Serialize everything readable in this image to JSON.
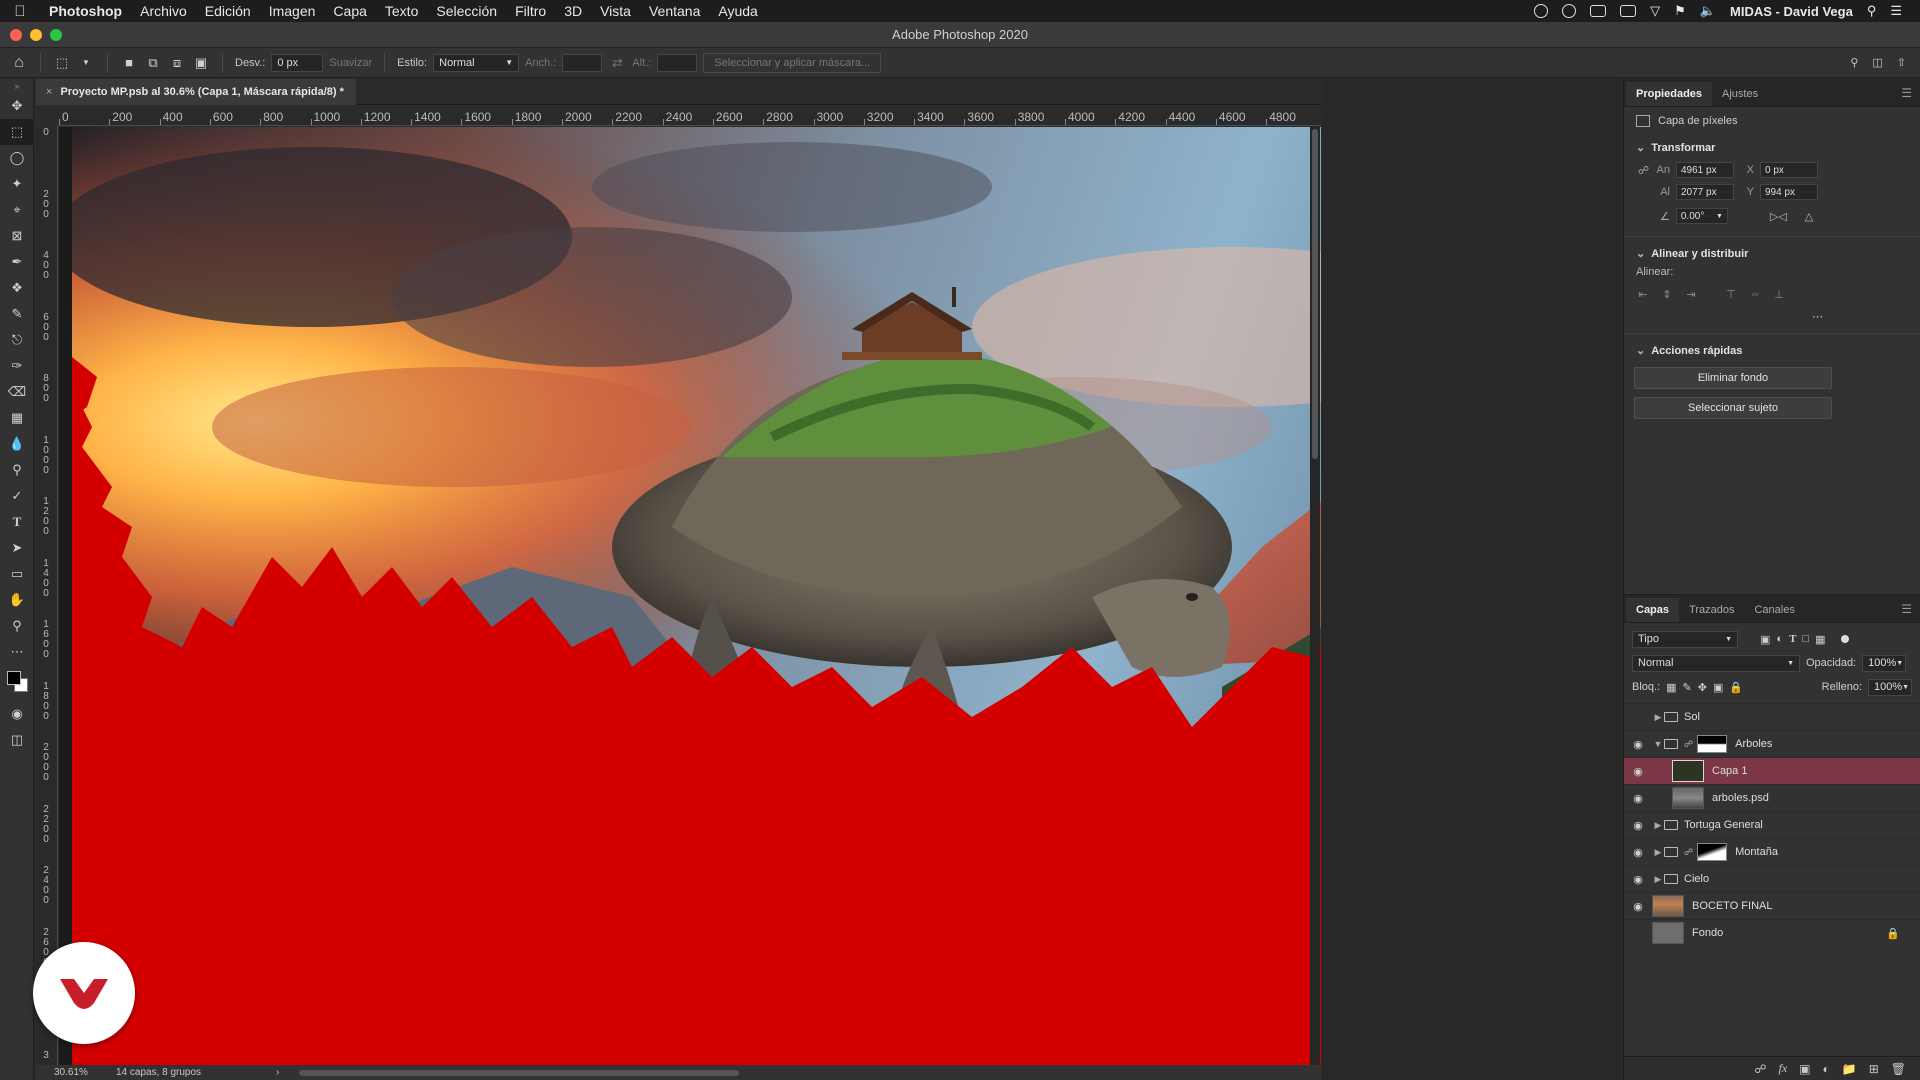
{
  "menubar": {
    "app_name": "Photoshop",
    "items": [
      "Archivo",
      "Edición",
      "Imagen",
      "Capa",
      "Texto",
      "Selección",
      "Filtro",
      "3D",
      "Vista",
      "Ventana",
      "Ayuda"
    ],
    "user": "MIDAS - David Vega"
  },
  "window": {
    "title": "Adobe Photoshop 2020"
  },
  "options": {
    "feather_label": "Desv.:",
    "feather_value": "0 px",
    "smooth_label": "Suavizar",
    "style_label": "Estilo:",
    "style_value": "Normal",
    "width_label": "Anch.:",
    "height_label": "Alt.:",
    "mask_button": "Seleccionar y aplicar máscara..."
  },
  "document": {
    "tab_title": "Proyecto MP.psb al 30.6% (Capa 1, Máscara rápida/8) *",
    "zoom": "30.61%",
    "status_info": "14 capas, 8 grupos"
  },
  "ruler": {
    "top_ticks": [
      "0",
      "200",
      "400",
      "600",
      "800",
      "1000",
      "1200",
      "1400",
      "1600",
      "1800",
      "2000",
      "2200",
      "2400",
      "2600",
      "2800",
      "3000",
      "3200",
      "3400",
      "3600",
      "3800",
      "4000",
      "4200",
      "4400",
      "4600",
      "4800"
    ],
    "left_ticks": [
      "0",
      "200",
      "400",
      "600",
      "800",
      "1000",
      "1200",
      "1400",
      "1600",
      "1800",
      "2000",
      "2200",
      "2400",
      "2600",
      "2800",
      "3"
    ]
  },
  "properties": {
    "tabs": [
      "Propiedades",
      "Ajustes"
    ],
    "layer_type": "Capa de píxeles",
    "transform_title": "Transformar",
    "width_label": "An",
    "width_value": "4961 px",
    "height_label": "Al",
    "height_value": "2077 px",
    "x_label": "X",
    "x_value": "0 px",
    "y_label": "Y",
    "y_value": "994 px",
    "angle_value": "0.00°",
    "align_title": "Alinear y distribuir",
    "align_label": "Alinear:",
    "quick_actions_title": "Acciones rápidas",
    "remove_bg_button": "Eliminar fondo",
    "select_subject_button": "Seleccionar sujeto"
  },
  "layers_panel": {
    "tabs": [
      "Capas",
      "Trazados",
      "Canales"
    ],
    "filter_value": "Tipo",
    "blend_mode": "Normal",
    "opacity_label": "Opacidad:",
    "opacity_value": "100%",
    "lock_label": "Bloq.:",
    "fill_label": "Relleno:",
    "fill_value": "100%",
    "layers": [
      {
        "name": "Sol",
        "kind": "group",
        "visible": false,
        "indent": 0,
        "expanded": false
      },
      {
        "name": "Arboles",
        "kind": "group-mask",
        "visible": true,
        "indent": 0,
        "expanded": true
      },
      {
        "name": "Capa 1",
        "kind": "pixel",
        "visible": true,
        "indent": 1,
        "selected": true
      },
      {
        "name": "arboles.psd",
        "kind": "smart",
        "visible": true,
        "indent": 1
      },
      {
        "name": "Tortuga General",
        "kind": "group",
        "visible": true,
        "indent": 0,
        "expanded": false
      },
      {
        "name": "Montaña",
        "kind": "group-mask",
        "visible": true,
        "indent": 0,
        "expanded": false
      },
      {
        "name": "Cielo",
        "kind": "group",
        "visible": true,
        "indent": 0,
        "expanded": false
      },
      {
        "name": "BOCETO FINAL",
        "kind": "image",
        "visible": true,
        "indent": 0
      },
      {
        "name": "Fondo",
        "kind": "background",
        "visible": false,
        "indent": 0,
        "locked": true
      }
    ]
  },
  "colors": {
    "accent_selected_layer": "#7b3745",
    "quick_mask_red": "#d40000",
    "logo_red": "#c81e2c"
  }
}
